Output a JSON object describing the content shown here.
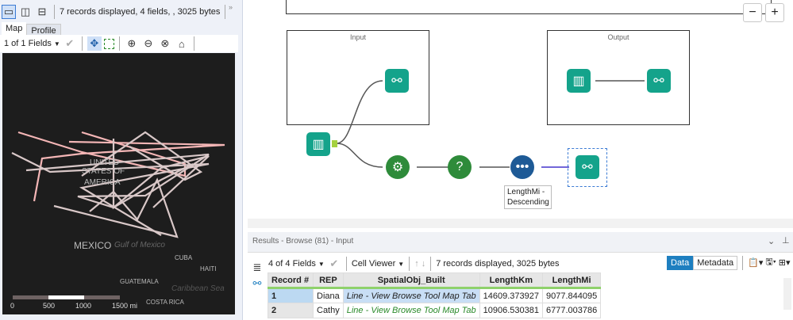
{
  "left_panel": {
    "status": "7 records displayed, 4 fields, , 3025 bytes",
    "tabs": [
      {
        "label": "Map",
        "active": true
      },
      {
        "label": "Profile",
        "active": false
      }
    ],
    "fields_select": "1 of 1 Fields",
    "map": {
      "labels": {
        "usa_1": "UNITED",
        "usa_2": "STATES OF",
        "usa_3": "AMERICA",
        "mexico": "MEXICO",
        "gulf": "Gulf of Mexico",
        "cuba": "CUBA",
        "haiti": "HAITI",
        "guatemala": "GUATEMALA",
        "caribbean": "Caribbean Sea",
        "costa_rica": "COSTA RICA"
      },
      "scale": [
        "0",
        "500",
        "1000",
        "1500 mi"
      ],
      "line_colors": [
        "#f4b6b6",
        "#d9c8c8"
      ]
    }
  },
  "canvas": {
    "containers": [
      {
        "title": "Input"
      },
      {
        "title": "Output"
      }
    ],
    "sort_annotation": "LengthMi - Descending",
    "zoom_out": "−",
    "zoom_in": "+"
  },
  "results": {
    "title": "Results - Browse (81) - Input",
    "fields_select": "4 of 4 Fields",
    "cell_viewer": "Cell Viewer",
    "status": "7 records displayed, 3025 bytes",
    "data_btn": "Data",
    "metadata_btn": "Metadata",
    "columns": [
      "Record #",
      "REP",
      "SpatialObj_Built",
      "LengthKm",
      "LengthMi"
    ],
    "rows": [
      [
        "1",
        "Diana",
        "Line - View Browse Tool Map Tab",
        "14609.373927",
        "9077.844095"
      ],
      [
        "2",
        "Cathy",
        "Line - View Browse Tool Map Tab",
        "10906.530381",
        "6777.003786"
      ]
    ]
  }
}
